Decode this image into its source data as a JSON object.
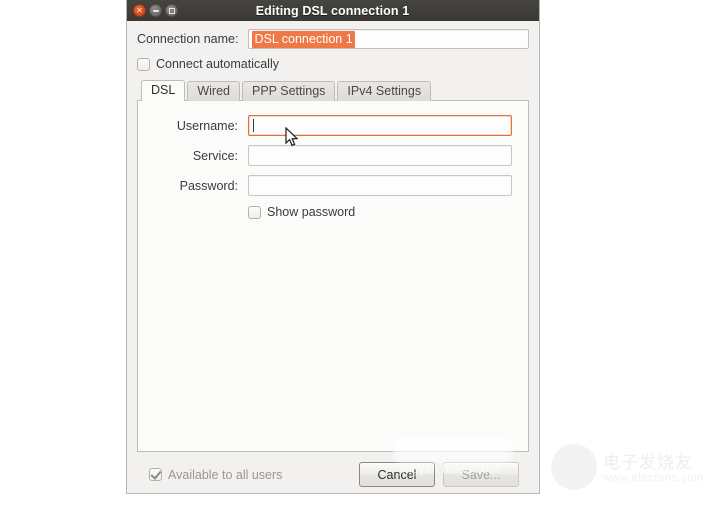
{
  "window": {
    "title": "Editing DSL connection 1",
    "controls": [
      {
        "name": "close",
        "glyph": "✕"
      },
      {
        "name": "minimize",
        "glyph": "–"
      },
      {
        "name": "maximize",
        "glyph": "□"
      }
    ]
  },
  "connection": {
    "name_label": "Connection name:",
    "name_value": "DSL connection 1",
    "name_placeholder": "",
    "name_selected": true,
    "autoconnect_label": "Connect automatically",
    "autoconnect_checked": false
  },
  "tabs": [
    {
      "label": "DSL",
      "active": true
    },
    {
      "label": "Wired",
      "active": false
    },
    {
      "label": "PPP Settings",
      "active": false
    },
    {
      "label": "IPv4 Settings",
      "active": false
    }
  ],
  "dsl_form": {
    "username_label": "Username:",
    "username_value": "",
    "username_placeholder": "",
    "username_focused": true,
    "service_label": "Service:",
    "service_value": "",
    "service_placeholder": "",
    "password_label": "Password:",
    "password_value": "",
    "password_placeholder": "",
    "show_password_label": "Show password",
    "show_password_checked": false
  },
  "footer": {
    "available_all_users_label": "Available to all users",
    "available_all_users_checked": true,
    "available_all_users_disabled": true,
    "cancel_label": "Cancel",
    "save_label": "Save...",
    "save_disabled": true
  },
  "watermarks": {
    "site_text": "jingyan.baidu.com",
    "logo_cn": "电子发烧友",
    "logo_url": "www.elecfans.com"
  },
  "colors": {
    "titlebar": "#3c3b37",
    "selection_orange": "#f07746",
    "focus_border": "#e2703c",
    "window_bg": "#f2f1f0",
    "page_bg": "#fbfbfa"
  }
}
